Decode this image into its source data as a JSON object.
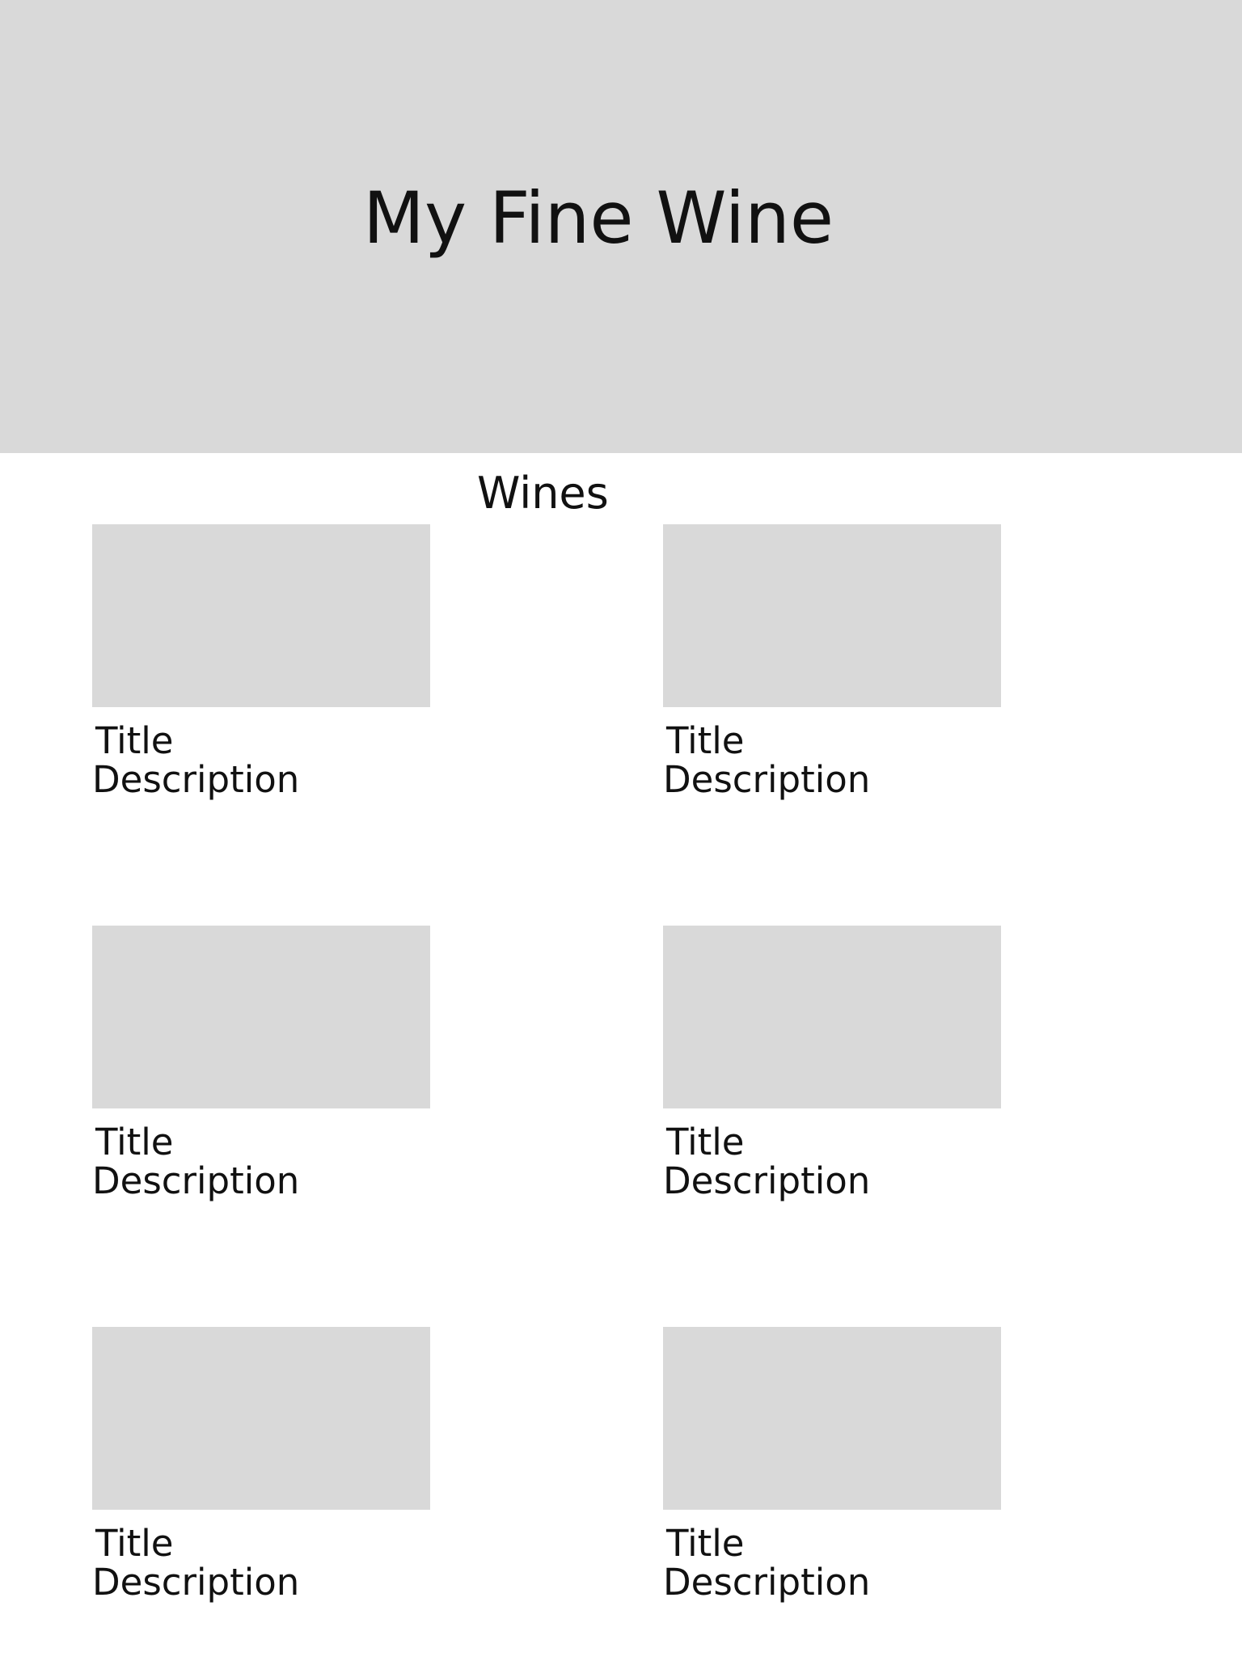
{
  "hero": {
    "title": "My Fine Wine",
    "background": "#d9d9d9"
  },
  "section": {
    "title": "Wines"
  },
  "wines": [
    {
      "title": "Title",
      "description": "Description"
    },
    {
      "title": "Title",
      "description": "Description"
    },
    {
      "title": "Title",
      "description": "Description"
    },
    {
      "title": "Title",
      "description": "Description"
    },
    {
      "title": "Title",
      "description": "Description"
    },
    {
      "title": "Title",
      "description": "Description"
    }
  ]
}
